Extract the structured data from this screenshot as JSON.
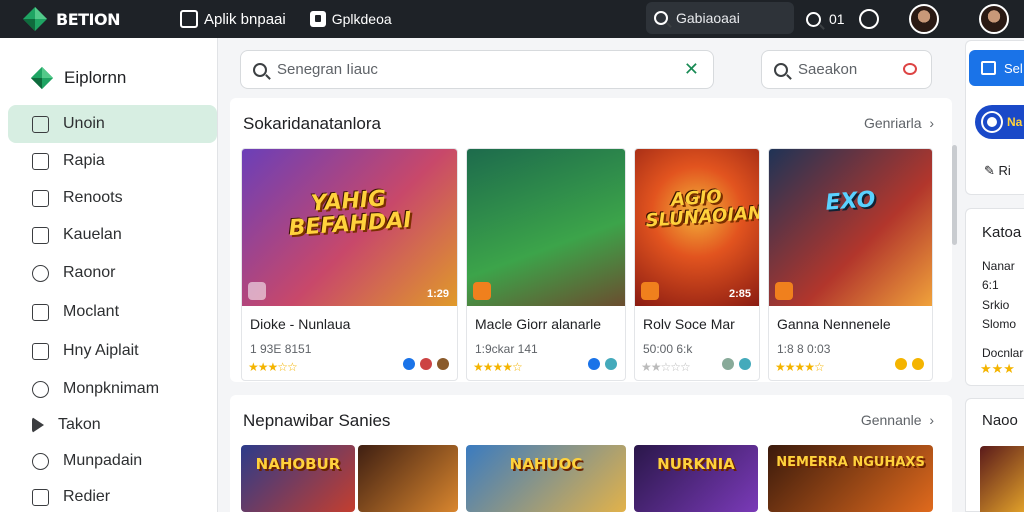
{
  "topbar": {
    "brand": "BETION",
    "nav": [
      {
        "label": "Aplik bnpaai",
        "icon": "window-icon"
      },
      {
        "label": "Gplkdeoa",
        "icon": "store-icon"
      }
    ],
    "search_placeholder": "Gabiaoaai",
    "counter": "01"
  },
  "sidebar": {
    "title": "Eiplornn",
    "items": [
      {
        "label": "Unoin",
        "icon": "folder-icon",
        "active": true
      },
      {
        "label": "Rapia",
        "icon": "square-icon"
      },
      {
        "label": "Renoots",
        "icon": "list-icon"
      },
      {
        "label": "Kauelan",
        "icon": "calendar-icon"
      },
      {
        "label": "Raonor",
        "icon": "badge-icon"
      },
      {
        "label": "Moclant",
        "icon": "document-icon"
      },
      {
        "label": "Hny Aiplait",
        "icon": "file-icon"
      },
      {
        "label": "Monpknimam",
        "icon": "globe-icon"
      },
      {
        "label": "Takon",
        "icon": "play-icon"
      },
      {
        "label": "Munpadain",
        "icon": "compass-icon"
      },
      {
        "label": "Redier",
        "icon": "edit-icon"
      }
    ]
  },
  "main": {
    "search_placeholder": "Senegran Iiauc",
    "search2_placeholder": "Saeakon",
    "section1": {
      "title": "Sokaridanatanlora",
      "more": "Genriarla",
      "cards": [
        {
          "art": "YAHIG BEFAHDAI",
          "num": "1:29",
          "title": "Dioke - Nunlaua",
          "meta": "1 93E 8151",
          "stars": "★★★☆☆",
          "colors": [
            "#6b3fb8",
            "#c8486a",
            "#e09a2a"
          ]
        },
        {
          "art": "",
          "num": "",
          "title": "Macle Giorr alanarle",
          "meta": "1:9ckar 141",
          "stars": "★★★★☆",
          "colors": [
            "#1d6b4c",
            "#3ca44a",
            "#6b4d2f"
          ]
        },
        {
          "art": "AGIO SLUNAOIAN",
          "num": "2:85",
          "title": "Rolv Soce Mar",
          "meta": "50:00 6:k",
          "stars": "★★☆☆☆",
          "colors": [
            "#8a1b12",
            "#e2541f",
            "#f3b33a"
          ]
        },
        {
          "art": "EXO",
          "num": "",
          "title": "Ganna Nennenele",
          "meta": "1:8 8 0:03",
          "stars": "★★★★☆",
          "colors": [
            "#1f3356",
            "#b2362c",
            "#f0a23b"
          ]
        }
      ]
    },
    "section2": {
      "title": "Nepnawibar Sanies",
      "more": "Gennanle",
      "cards": [
        {
          "art": "NAHOBUR",
          "colors": [
            "#2c3b8a",
            "#c43e2f"
          ]
        },
        {
          "art": "",
          "colors": [
            "#3f1f12",
            "#d9862e"
          ]
        },
        {
          "art": "NAHUOC",
          "colors": [
            "#3a7bc0",
            "#e2b24a"
          ]
        },
        {
          "art": "NURKNIA",
          "colors": [
            "#2a174a",
            "#7a3ab8"
          ]
        },
        {
          "art": "NEMERRA NGUHAXS",
          "colors": [
            "#3a1a0c",
            "#e06a1d"
          ]
        }
      ]
    }
  },
  "right": {
    "button_label": "Sel",
    "pill_label": "Na",
    "link_label": "Ri",
    "panel_title": "Katoa",
    "panel_lines": [
      "Nanar",
      "6:1",
      "Srkio",
      "Slomo"
    ],
    "panel_foot": "Docnlar",
    "section_title": "Naoo"
  },
  "colors": {
    "topbar": "#1e2227",
    "accent": "#1a73e8",
    "active_bg": "#d7eee2",
    "brand_green": "#1fa463"
  }
}
